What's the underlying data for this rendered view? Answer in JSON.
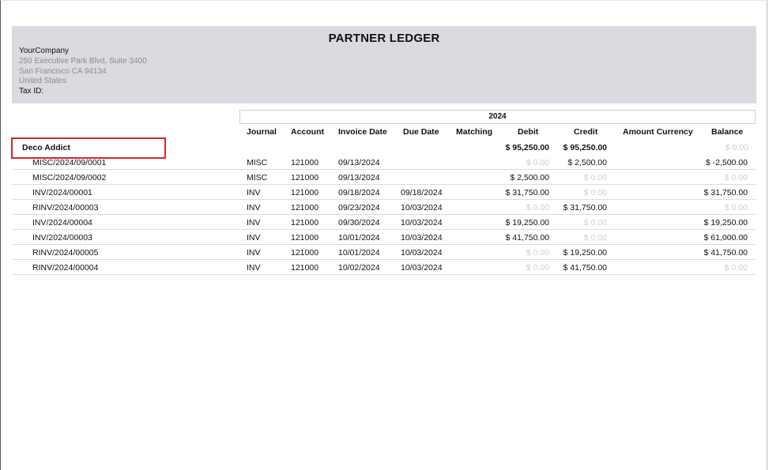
{
  "report": {
    "title": "PARTNER LEDGER",
    "company": {
      "name": "YourCompany",
      "street": "250 Executive Park Blvd, Suite 3400",
      "city": "San Francisco CA 94134",
      "country": "United States",
      "tax_id_label": "Tax ID:"
    },
    "period_label": "2024"
  },
  "columns": {
    "journal": "Journal",
    "account": "Account",
    "invoice_date": "Invoice Date",
    "due_date": "Due Date",
    "matching": "Matching",
    "debit": "Debit",
    "credit": "Credit",
    "amount_currency": "Amount Currency",
    "balance": "Balance"
  },
  "partner": {
    "name": "Deco Addict",
    "debit": "$ 95,250.00",
    "credit": "$ 95,250.00",
    "balance": "$ 0.00"
  },
  "rows": [
    {
      "move": "MISC/2024/09/0001",
      "journal": "MISC",
      "account": "121000",
      "invoice_date": "09/13/2024",
      "due_date": "",
      "debit": "$ 0.00",
      "credit": "$ 2,500.00",
      "balance": "$ -2,500.00"
    },
    {
      "move": "MISC/2024/09/0002",
      "journal": "MISC",
      "account": "121000",
      "invoice_date": "09/13/2024",
      "due_date": "",
      "debit": "$ 2,500.00",
      "credit": "$ 0.00",
      "balance": "$ 0.00"
    },
    {
      "move": "INV/2024/00001",
      "journal": "INV",
      "account": "121000",
      "invoice_date": "09/18/2024",
      "due_date": "09/18/2024",
      "debit": "$ 31,750.00",
      "credit": "$ 0.00",
      "balance": "$ 31,750.00"
    },
    {
      "move": "RINV/2024/00003",
      "journal": "INV",
      "account": "121000",
      "invoice_date": "09/23/2024",
      "due_date": "10/03/2024",
      "debit": "$ 0.00",
      "credit": "$ 31,750.00",
      "balance": "$ 0.00"
    },
    {
      "move": "INV/2024/00004",
      "journal": "INV",
      "account": "121000",
      "invoice_date": "09/30/2024",
      "due_date": "10/03/2024",
      "debit": "$ 19,250.00",
      "credit": "$ 0.00",
      "balance": "$ 19,250.00"
    },
    {
      "move": "INV/2024/00003",
      "journal": "INV",
      "account": "121000",
      "invoice_date": "10/01/2024",
      "due_date": "10/03/2024",
      "debit": "$ 41,750.00",
      "credit": "$ 0.00",
      "balance": "$ 61,000.00"
    },
    {
      "move": "RINV/2024/00005",
      "journal": "INV",
      "account": "121000",
      "invoice_date": "10/01/2024",
      "due_date": "10/03/2024",
      "debit": "$ 0.00",
      "credit": "$ 19,250.00",
      "balance": "$ 41,750.00"
    },
    {
      "move": "RINV/2024/00004",
      "journal": "INV",
      "account": "121000",
      "invoice_date": "10/02/2024",
      "due_date": "10/03/2024",
      "debit": "$ 0.00",
      "credit": "$ 41,750.00",
      "balance": "$ 0.00"
    }
  ],
  "colors": {
    "header_band": "#d9dbe0",
    "highlight_border": "#d8262c",
    "zero_amount": "#cfcfcf"
  }
}
